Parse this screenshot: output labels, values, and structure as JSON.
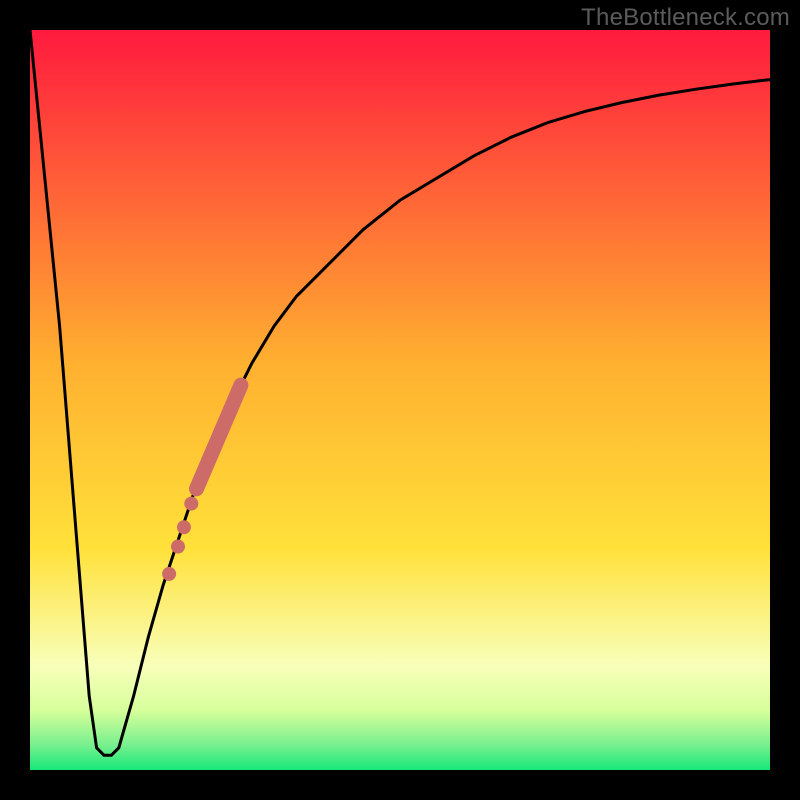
{
  "watermark": "TheBottleneck.com",
  "colors": {
    "frame": "#000000",
    "curve": "#000000",
    "markers": "#cd6b68",
    "gradient_top": "#ff1a3e",
    "gradient_yellow": "#ffe13a",
    "gradient_pale": "#f7ffc9",
    "gradient_green": "#17e879"
  },
  "chart_data": {
    "type": "line",
    "title": "",
    "xlabel": "",
    "ylabel": "",
    "xlim": [
      0,
      100
    ],
    "ylim": [
      0,
      100
    ],
    "grid": false,
    "legend": false,
    "series": [
      {
        "name": "bottleneck-curve",
        "x": [
          0,
          4,
          8,
          9,
          10,
          11,
          12,
          14,
          16,
          18,
          20,
          22,
          24,
          26,
          28,
          30,
          33,
          36,
          40,
          45,
          50,
          55,
          60,
          65,
          70,
          75,
          80,
          85,
          90,
          95,
          100
        ],
        "y": [
          100,
          60,
          10,
          3,
          2,
          2,
          3,
          10,
          18,
          25,
          31,
          37,
          42,
          47,
          51,
          55,
          60,
          64,
          68,
          73,
          77,
          80,
          83,
          85.5,
          87.5,
          89,
          90.2,
          91.2,
          92,
          92.7,
          93.3
        ]
      }
    ],
    "markers": {
      "name": "highlighted-range",
      "stroke_segment": {
        "x": [
          22.5,
          28.5
        ],
        "y": [
          38,
          52
        ]
      },
      "dots": [
        {
          "x": 21.8,
          "y": 36.0
        },
        {
          "x": 20.8,
          "y": 32.8
        },
        {
          "x": 20.0,
          "y": 30.2
        },
        {
          "x": 18.8,
          "y": 26.5
        }
      ]
    },
    "gradient_stops": [
      {
        "offset": 0.0,
        "color": "#ff1a3e"
      },
      {
        "offset": 0.45,
        "color": "#ffb030"
      },
      {
        "offset": 0.7,
        "color": "#ffe13a"
      },
      {
        "offset": 0.86,
        "color": "#f8ffba"
      },
      {
        "offset": 0.92,
        "color": "#d6ff9a"
      },
      {
        "offset": 0.965,
        "color": "#7af08f"
      },
      {
        "offset": 1.0,
        "color": "#17e879"
      }
    ]
  }
}
